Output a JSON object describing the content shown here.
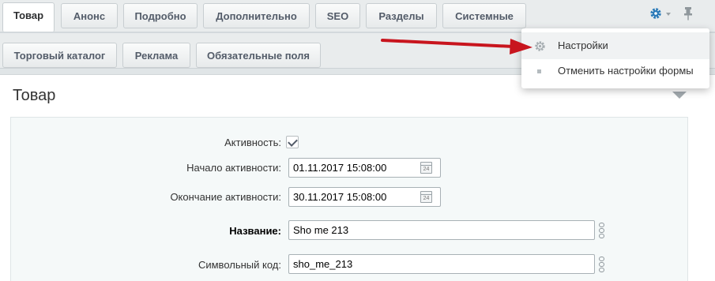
{
  "tabs_row1": [
    {
      "label": "Товар",
      "active": true
    },
    {
      "label": "Анонс",
      "active": false
    },
    {
      "label": "Подробно",
      "active": false
    },
    {
      "label": "Дополнительно",
      "active": false
    },
    {
      "label": "SEO",
      "active": false
    },
    {
      "label": "Разделы",
      "active": false
    },
    {
      "label": "Системные",
      "active": false
    }
  ],
  "tabs_row2": [
    {
      "label": "Торговый каталог"
    },
    {
      "label": "Реклама"
    },
    {
      "label": "Обязательные поля"
    }
  ],
  "toolbar_icons": [
    "gear-icon",
    "pin-icon"
  ],
  "settings_menu": {
    "items": [
      {
        "label": "Настройки",
        "icon": "gear-icon",
        "highlighted": true
      },
      {
        "label": "Отменить настройки формы",
        "icon": "square-bullet",
        "highlighted": false
      }
    ]
  },
  "section": {
    "title": "Товар"
  },
  "form": {
    "active_label": "Активность:",
    "active_checked": true,
    "start_label": "Начало активности:",
    "start_value": "01.11.2017 15:08:00",
    "end_label": "Окончание активности:",
    "end_value": "30.11.2017 15:08:00",
    "name_label": "Название:",
    "name_value": "Sho me 213",
    "code_label": "Символьный код:",
    "code_value": "sho_me_213",
    "calendar_day": "24"
  },
  "colors": {
    "accent_arrow": "#c8151e",
    "gear_blue": "#2a7ab8"
  }
}
